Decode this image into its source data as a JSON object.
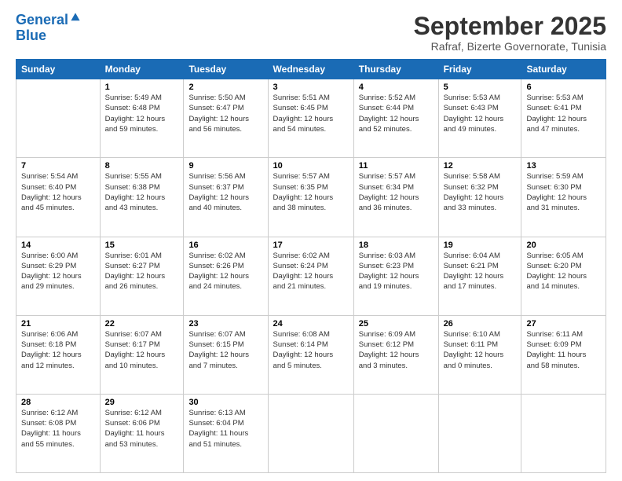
{
  "logo": {
    "line1": "General",
    "line2": "Blue"
  },
  "title": "September 2025",
  "subtitle": "Rafraf, Bizerte Governorate, Tunisia",
  "days_header": [
    "Sunday",
    "Monday",
    "Tuesday",
    "Wednesday",
    "Thursday",
    "Friday",
    "Saturday"
  ],
  "weeks": [
    [
      {
        "day": "",
        "info": ""
      },
      {
        "day": "1",
        "info": "Sunrise: 5:49 AM\nSunset: 6:48 PM\nDaylight: 12 hours\nand 59 minutes."
      },
      {
        "day": "2",
        "info": "Sunrise: 5:50 AM\nSunset: 6:47 PM\nDaylight: 12 hours\nand 56 minutes."
      },
      {
        "day": "3",
        "info": "Sunrise: 5:51 AM\nSunset: 6:45 PM\nDaylight: 12 hours\nand 54 minutes."
      },
      {
        "day": "4",
        "info": "Sunrise: 5:52 AM\nSunset: 6:44 PM\nDaylight: 12 hours\nand 52 minutes."
      },
      {
        "day": "5",
        "info": "Sunrise: 5:53 AM\nSunset: 6:43 PM\nDaylight: 12 hours\nand 49 minutes."
      },
      {
        "day": "6",
        "info": "Sunrise: 5:53 AM\nSunset: 6:41 PM\nDaylight: 12 hours\nand 47 minutes."
      }
    ],
    [
      {
        "day": "7",
        "info": "Sunrise: 5:54 AM\nSunset: 6:40 PM\nDaylight: 12 hours\nand 45 minutes."
      },
      {
        "day": "8",
        "info": "Sunrise: 5:55 AM\nSunset: 6:38 PM\nDaylight: 12 hours\nand 43 minutes."
      },
      {
        "day": "9",
        "info": "Sunrise: 5:56 AM\nSunset: 6:37 PM\nDaylight: 12 hours\nand 40 minutes."
      },
      {
        "day": "10",
        "info": "Sunrise: 5:57 AM\nSunset: 6:35 PM\nDaylight: 12 hours\nand 38 minutes."
      },
      {
        "day": "11",
        "info": "Sunrise: 5:57 AM\nSunset: 6:34 PM\nDaylight: 12 hours\nand 36 minutes."
      },
      {
        "day": "12",
        "info": "Sunrise: 5:58 AM\nSunset: 6:32 PM\nDaylight: 12 hours\nand 33 minutes."
      },
      {
        "day": "13",
        "info": "Sunrise: 5:59 AM\nSunset: 6:30 PM\nDaylight: 12 hours\nand 31 minutes."
      }
    ],
    [
      {
        "day": "14",
        "info": "Sunrise: 6:00 AM\nSunset: 6:29 PM\nDaylight: 12 hours\nand 29 minutes."
      },
      {
        "day": "15",
        "info": "Sunrise: 6:01 AM\nSunset: 6:27 PM\nDaylight: 12 hours\nand 26 minutes."
      },
      {
        "day": "16",
        "info": "Sunrise: 6:02 AM\nSunset: 6:26 PM\nDaylight: 12 hours\nand 24 minutes."
      },
      {
        "day": "17",
        "info": "Sunrise: 6:02 AM\nSunset: 6:24 PM\nDaylight: 12 hours\nand 21 minutes."
      },
      {
        "day": "18",
        "info": "Sunrise: 6:03 AM\nSunset: 6:23 PM\nDaylight: 12 hours\nand 19 minutes."
      },
      {
        "day": "19",
        "info": "Sunrise: 6:04 AM\nSunset: 6:21 PM\nDaylight: 12 hours\nand 17 minutes."
      },
      {
        "day": "20",
        "info": "Sunrise: 6:05 AM\nSunset: 6:20 PM\nDaylight: 12 hours\nand 14 minutes."
      }
    ],
    [
      {
        "day": "21",
        "info": "Sunrise: 6:06 AM\nSunset: 6:18 PM\nDaylight: 12 hours\nand 12 minutes."
      },
      {
        "day": "22",
        "info": "Sunrise: 6:07 AM\nSunset: 6:17 PM\nDaylight: 12 hours\nand 10 minutes."
      },
      {
        "day": "23",
        "info": "Sunrise: 6:07 AM\nSunset: 6:15 PM\nDaylight: 12 hours\nand 7 minutes."
      },
      {
        "day": "24",
        "info": "Sunrise: 6:08 AM\nSunset: 6:14 PM\nDaylight: 12 hours\nand 5 minutes."
      },
      {
        "day": "25",
        "info": "Sunrise: 6:09 AM\nSunset: 6:12 PM\nDaylight: 12 hours\nand 3 minutes."
      },
      {
        "day": "26",
        "info": "Sunrise: 6:10 AM\nSunset: 6:11 PM\nDaylight: 12 hours\nand 0 minutes."
      },
      {
        "day": "27",
        "info": "Sunrise: 6:11 AM\nSunset: 6:09 PM\nDaylight: 11 hours\nand 58 minutes."
      }
    ],
    [
      {
        "day": "28",
        "info": "Sunrise: 6:12 AM\nSunset: 6:08 PM\nDaylight: 11 hours\nand 55 minutes."
      },
      {
        "day": "29",
        "info": "Sunrise: 6:12 AM\nSunset: 6:06 PM\nDaylight: 11 hours\nand 53 minutes."
      },
      {
        "day": "30",
        "info": "Sunrise: 6:13 AM\nSunset: 6:04 PM\nDaylight: 11 hours\nand 51 minutes."
      },
      {
        "day": "",
        "info": ""
      },
      {
        "day": "",
        "info": ""
      },
      {
        "day": "",
        "info": ""
      },
      {
        "day": "",
        "info": ""
      }
    ]
  ]
}
